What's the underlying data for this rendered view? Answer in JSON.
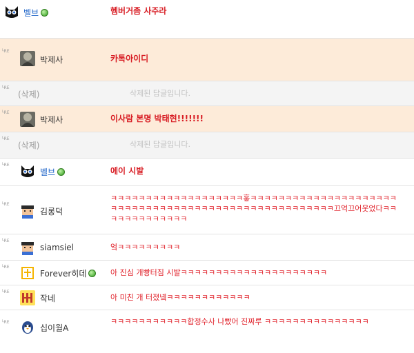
{
  "comments": [
    {
      "reply_mark": "",
      "author": "벨브",
      "online": true,
      "message": "헴버거좀 사주라",
      "deleted": false
    },
    {
      "reply_mark": "└RE",
      "author": "박제사",
      "online": false,
      "message": "카톡아이디",
      "deleted": false
    },
    {
      "reply_mark": "└RE",
      "author": "(삭제)",
      "online": false,
      "message": "삭제된 답글입니다.",
      "deleted": true
    },
    {
      "reply_mark": "└RE",
      "author": "박제사",
      "online": false,
      "message": "이사람 본명 박태현!!!!!!!",
      "deleted": false
    },
    {
      "reply_mark": "└RE",
      "author": "(삭제)",
      "online": false,
      "message": "삭제된 답글입니다.",
      "deleted": true
    },
    {
      "reply_mark": "└RE",
      "author": "벨브",
      "online": true,
      "message": "에이 시발",
      "deleted": false
    },
    {
      "reply_mark": "└RE",
      "author": "김롱덕",
      "online": false,
      "message": "ㅋㅋㅋㅋㅋㅋㅋㅋㅋㅋㅋㅋㅋㅋㅋㅋㅋㅋㅋ흫ㅋㅋㅋㅋㅋㅋㅋㅋㅋㅋㅋㅋㅋㅋㅋㅋㅋㅋㅋㅋㅋㅋㅋㅋㅋㅋㅋㅋㅋㅋㅋㅋㅋㅋㅋㅋㅋㅋㅋㅋㅋㅋㅋㅋㅋㅋㅋㅋㅋㅋㅋㅋㅋ끄억끄어웃었다ㅋㅋㅋㅋㅋㅋㅋㅋㅋㅋㅋㅋㅋ",
      "deleted": false
    },
    {
      "reply_mark": "└RE",
      "author": "siamsiel",
      "online": false,
      "message": "엌ㅋㅋㅋㅋㅋㅋㅋㅋㅋ",
      "deleted": false
    },
    {
      "reply_mark": "└RE",
      "author": "Forever히데",
      "online": true,
      "message": "아 진심 개빵터짐 시발ㅋㅋㅋㅋㅋㅋㅋㅋㅋㅋㅋㅋㅋㅋㅋㅋㅋㅋㅋㅋㅋ",
      "deleted": false
    },
    {
      "reply_mark": "└RE",
      "author": "작네",
      "online": false,
      "message": "아 미친 개 터졌녴ㅋㅋㅋㅋㅋㅋㅋㅋㅋㅋㅋㅋ",
      "deleted": false
    },
    {
      "reply_mark": "└RE",
      "author": "십이월A",
      "online": false,
      "message": "ㅋㅋㅋㅋㅋㅋㅋㅋㅋㅋㅋ합정수사 나빴어 진짜루 ㅋㅋㅋㅋㅋㅋㅋㅋㅋㅋㅋㅋㅋㅋㅋ",
      "deleted": false
    }
  ],
  "colors": {
    "author_link": "#1e64c8",
    "message_red": "#e01f28",
    "highlight_row": "#fdebd9",
    "deleted_row": "#f4f4f4"
  },
  "icons": {
    "online": "online-status-icon",
    "reply": "reply-arrow-icon"
  }
}
